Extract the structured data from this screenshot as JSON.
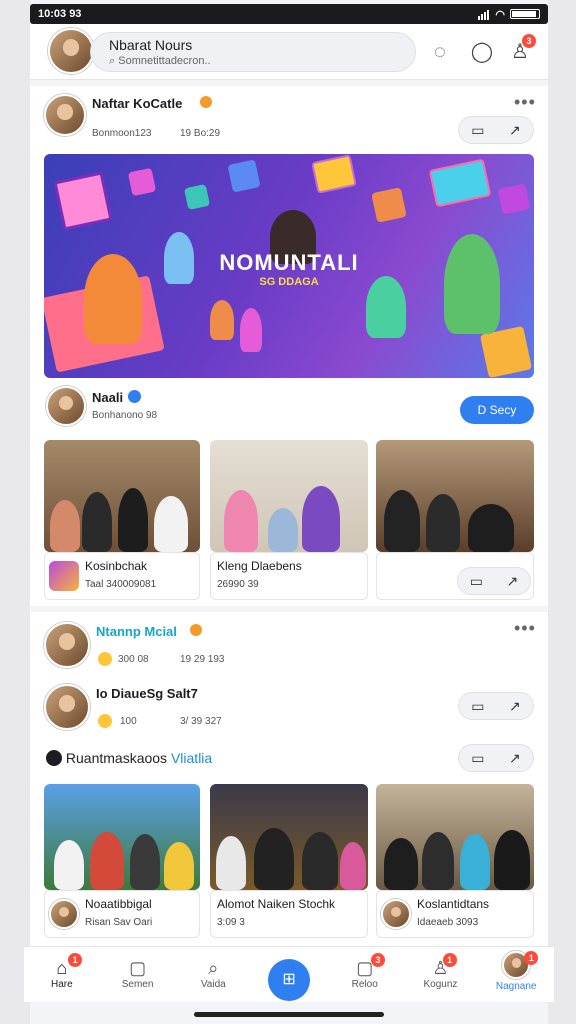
{
  "status": {
    "time": "10:03 93"
  },
  "header": {
    "title": "Nbarat Nours",
    "search_placeholder": "Somnetittadecron.."
  },
  "post1": {
    "author": "Naftar KoCatle",
    "meta1": "Bonmoon123",
    "meta2": "19 Bo:29",
    "banner_title": "NOMUNTALI",
    "banner_sub": "SG DDAGA"
  },
  "post2": {
    "author": "Naali",
    "meta": "Bonhanono 98",
    "follow_label": "D Secy",
    "tiles": [
      {
        "label": "Kosinbchak",
        "sub": "Taal 340009081"
      },
      {
        "label": "Kleng Dlaebens",
        "sub": "26990 39"
      }
    ]
  },
  "post3": {
    "author": "Ntannp Mcial",
    "meta1": "300 08",
    "meta2": "19 29 193"
  },
  "post4": {
    "author": "Io DiaueSg Salt7",
    "meta1": "100",
    "meta2": "3/ 39 327"
  },
  "section": {
    "title": "Ruantmaskaoos",
    "title_accent": "Vliatlia"
  },
  "grid": [
    {
      "label": "Noaatibbigal",
      "sub": "Risan Sav Oari"
    },
    {
      "label": "Alomot Naiken Stochk",
      "sub": "3:09 3 "
    },
    {
      "label": "Koslantidtans",
      "sub": "Idaeaeb 3093"
    }
  ],
  "nav": [
    {
      "label": "Hare",
      "badge": "1"
    },
    {
      "label": "Semen",
      "badge": ""
    },
    {
      "label": "Vaida",
      "badge": ""
    },
    {
      "label": "",
      "badge": ""
    },
    {
      "label": "Reloo",
      "badge": "3"
    },
    {
      "label": "Kogunz",
      "badge": "1"
    },
    {
      "label": "Nagnane",
      "badge": "1"
    }
  ],
  "header_badge": "3",
  "colors": {
    "accent": "#2f7ff0",
    "badge": "#ff4a3a"
  }
}
